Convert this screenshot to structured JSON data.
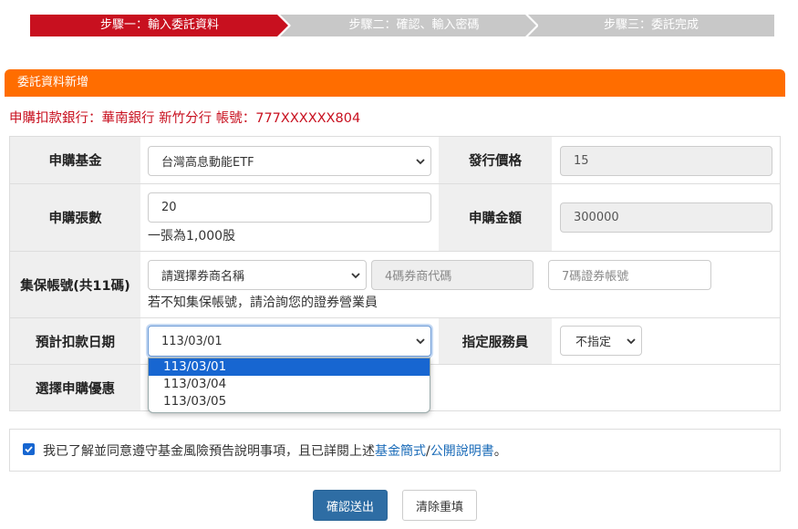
{
  "steps": [
    "步驟一：輸入委託資料",
    "步驟二：確認、輸入密碼",
    "步驟三：委託完成"
  ],
  "panel_title": "委託資料新增",
  "bank_line": "申購扣款銀行：華南銀行 新竹分行 帳號：777XXXXXX804",
  "fields": {
    "fund_label": "申購基金",
    "fund_value": "台灣高息動能ETF",
    "price_label": "發行價格",
    "price_value": "15",
    "qty_label": "申購張數",
    "qty_value": "20",
    "qty_note": "一張為1,000股",
    "amount_label": "申購金額",
    "amount_value": "300000",
    "custody_label": "集保帳號(共11碼)",
    "broker_select": "請選擇券商名稱",
    "broker_code_placeholder": "4碼券商代碼",
    "account_placeholder": "7碼證券帳號",
    "custody_note": "若不知集保帳號，請洽詢您的證券營業員",
    "date_label": "預計扣款日期",
    "date_value": "113/03/01",
    "agent_label": "指定服務員",
    "agent_value": "不指定",
    "promo_label": "選擇申購優惠"
  },
  "date_options": [
    "113/03/01",
    "113/03/04",
    "113/03/05"
  ],
  "agreement": {
    "text_before": "我已了解並同意遵守基金風險預告說明事項，且已詳閱上述",
    "link1": "基金簡式",
    "slash": "/",
    "link2": "公開說明書",
    "text_after": "。"
  },
  "buttons": {
    "submit": "確認送出",
    "reset": "清除重填"
  },
  "colors": {
    "step_active": "#c8101f",
    "step_inactive": "#c8c8c8",
    "header": "#ff6d00",
    "primary": "#2e6da4"
  }
}
